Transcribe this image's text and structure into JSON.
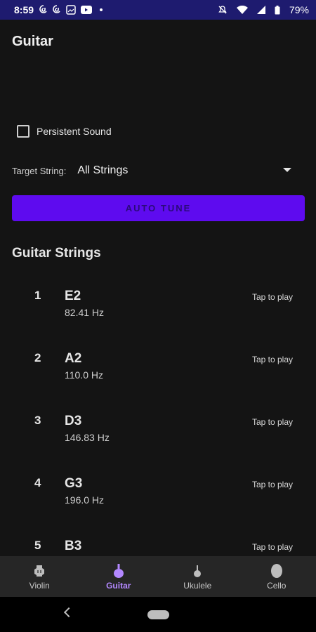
{
  "status_bar": {
    "time": "8:59",
    "battery": "79%",
    "icons": [
      "threads-icon",
      "threads-icon",
      "photos-icon",
      "youtube-icon",
      "dot-icon",
      "mute-icon",
      "wifi-icon",
      "signal-icon",
      "battery-icon"
    ]
  },
  "header": {
    "title": "Guitar"
  },
  "persistent_sound": {
    "label": "Persistent Sound",
    "checked": false
  },
  "target_string": {
    "label": "Target String:",
    "value": "All Strings"
  },
  "auto_tune": {
    "label": "AUTO TUNE"
  },
  "strings_section": {
    "title": "Guitar Strings",
    "tap_label": "Tap to play",
    "items": [
      {
        "index": "1",
        "note": "E2",
        "freq": "82.41 Hz"
      },
      {
        "index": "2",
        "note": "A2",
        "freq": "110.0 Hz"
      },
      {
        "index": "3",
        "note": "D3",
        "freq": "146.83 Hz"
      },
      {
        "index": "4",
        "note": "G3",
        "freq": "196.0 Hz"
      },
      {
        "index": "5",
        "note": "B3",
        "freq": ""
      }
    ]
  },
  "bottom_nav": {
    "items": [
      {
        "label": "Violin",
        "icon": "violin-icon",
        "active": false
      },
      {
        "label": "Guitar",
        "icon": "guitar-icon",
        "active": true
      },
      {
        "label": "Ukulele",
        "icon": "ukulele-icon",
        "active": false
      },
      {
        "label": "Cello",
        "icon": "cello-icon",
        "active": false
      }
    ]
  },
  "colors": {
    "status_bar": "#1e1b6f",
    "background": "#141414",
    "accent": "#5e0bef",
    "active_tab": "#b388ff"
  }
}
